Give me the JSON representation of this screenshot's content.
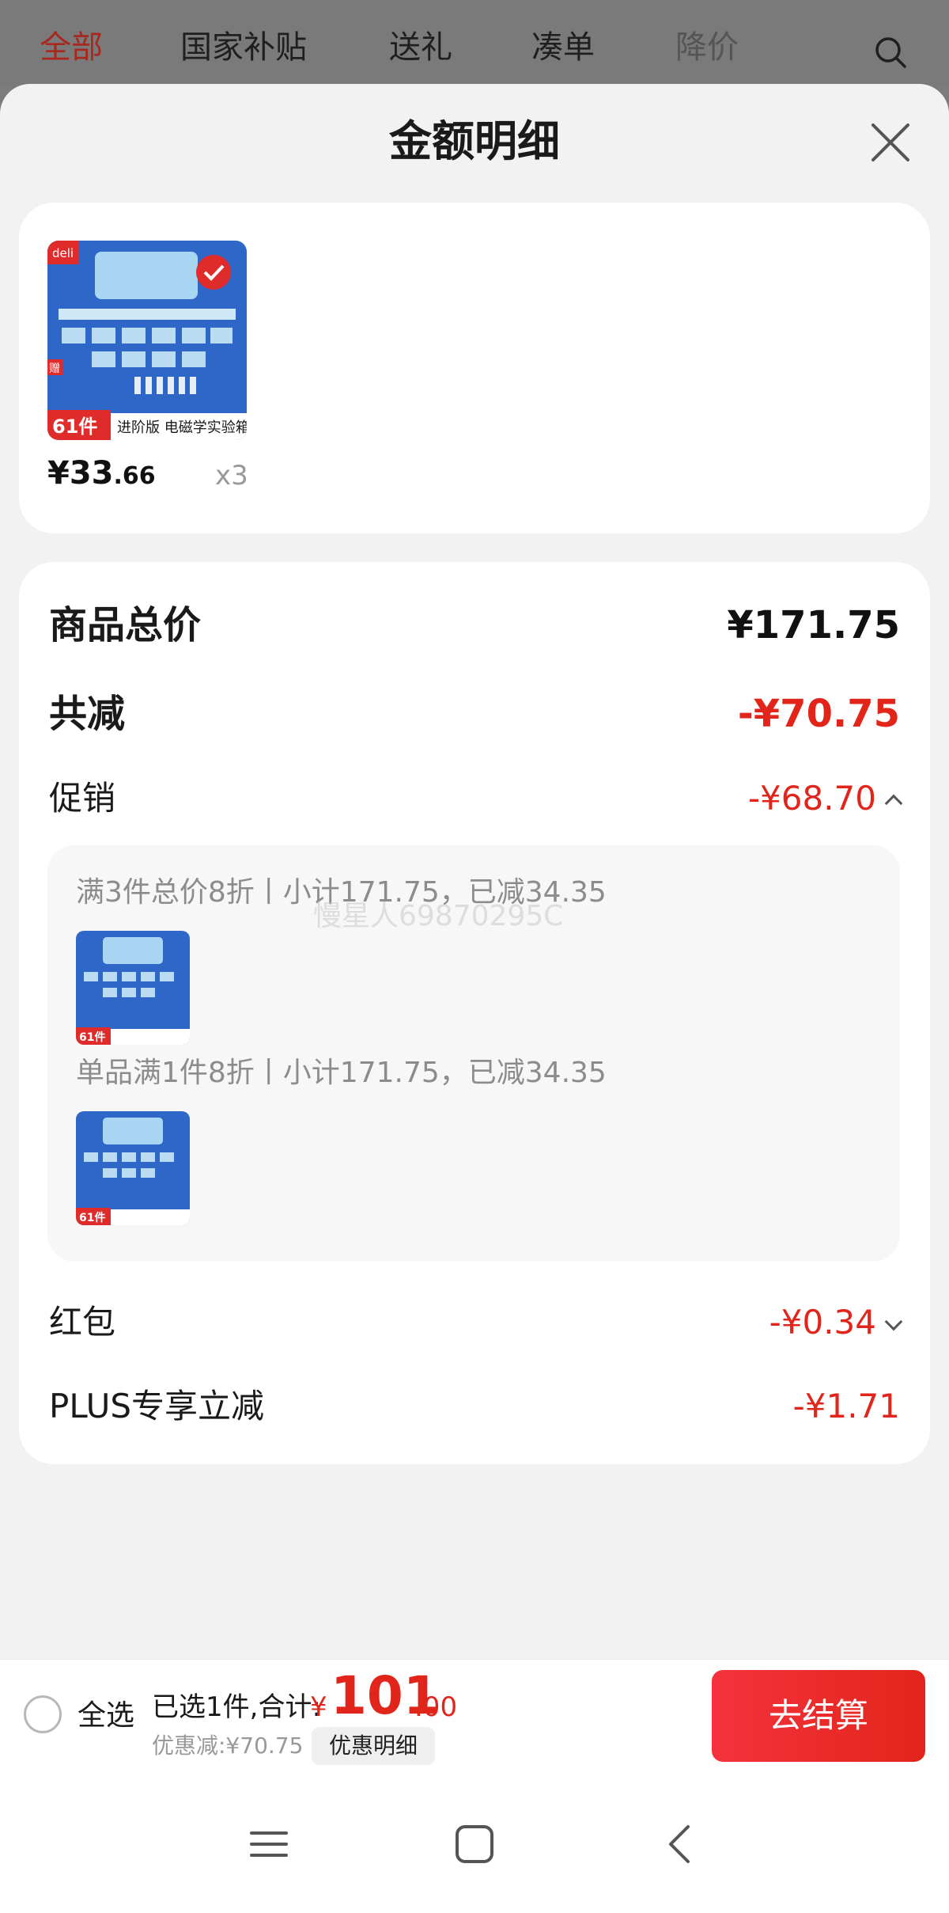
{
  "top_tabs": [
    {
      "label": "全部"
    },
    {
      "label": "国家补贴"
    },
    {
      "label": "送礼"
    },
    {
      "label": "凑单"
    },
    {
      "label": "降价"
    }
  ],
  "sheet": {
    "title": "金额明细"
  },
  "product": {
    "price_int": "¥33",
    "price_dec": ".66",
    "qty": "x3",
    "thumb_brand": "deli",
    "thumb_count": "61件",
    "thumb_caption": "进阶版 电磁学实验箱",
    "thumb_gift": "赠"
  },
  "summary": {
    "total_label": "商品总价",
    "total_value": "¥171.75",
    "discount_label": "共减",
    "discount_value": "-¥70.75",
    "promo_label": "促销",
    "promo_value": "-¥68.70",
    "promo_items": [
      {
        "text": "满3件总价8折丨小计171.75，已减34.35"
      },
      {
        "text": "单品满1件8折丨小计171.75，已减34.35"
      }
    ],
    "redpack_label": "红包",
    "redpack_value": "-¥0.34",
    "plus_label": "PLUS专享立减",
    "plus_value": "-¥1.71"
  },
  "watermark": "慢星人69870295C",
  "footer": {
    "select_all": "全选",
    "selected_info": "已选1件,合计:",
    "total_yen": "¥",
    "total_int": "101",
    "total_dec": ".00",
    "saved": "优惠减:¥70.75",
    "detail_button": "优惠明细",
    "checkout_button": "去结算"
  },
  "colors": {
    "accent_red": "#e1251b",
    "tab_active": "#a8281f",
    "sheet_bg": "#f2f2f2"
  }
}
